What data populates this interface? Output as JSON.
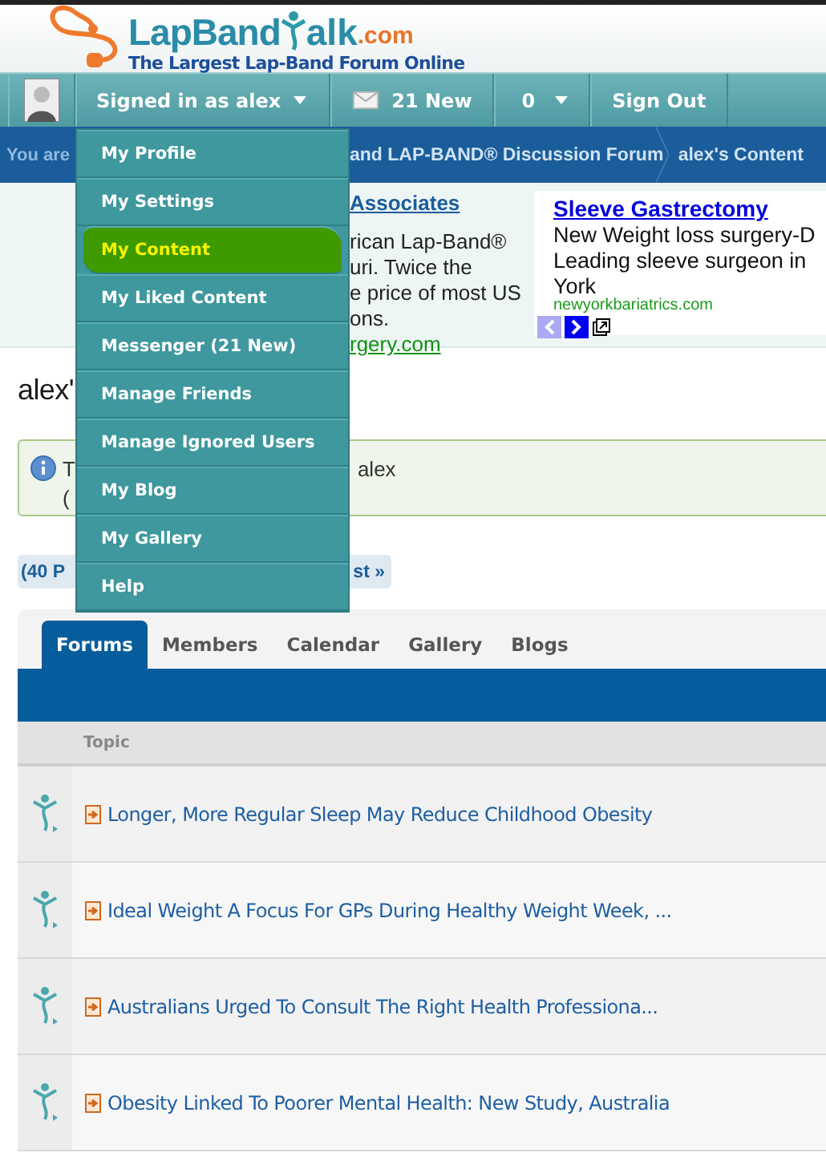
{
  "header": {
    "logo_parts": [
      "LapBand",
      "alk",
      ".com"
    ],
    "tagline": "The Largest Lap-Band Forum Online"
  },
  "nav": {
    "user": "Signed in as alex",
    "messages": "21 New",
    "notifications": "0",
    "sign_out": "Sign Out"
  },
  "breadcrumb": [
    "You are",
    "and LAP-BAND® Discussion Forum",
    "alex's Content"
  ],
  "user_menu": [
    {
      "label": "My Profile",
      "selected": false
    },
    {
      "label": "My Settings",
      "selected": false
    },
    {
      "label": "My Content",
      "selected": true
    },
    {
      "label": "My Liked Content",
      "selected": false
    },
    {
      "label": "Messenger (21 New)",
      "selected": false
    },
    {
      "label": "Manage Friends",
      "selected": false
    },
    {
      "label": "Manage Ignored Users",
      "selected": false
    },
    {
      "label": "My Blog",
      "selected": false
    },
    {
      "label": "My Gallery",
      "selected": false
    },
    {
      "label": "Help",
      "selected": false
    }
  ],
  "ads": {
    "left": {
      "title": "Associates",
      "lines": [
        "rican Lap-Band®",
        "uri. Twice the",
        "e price of most US",
        "ons."
      ],
      "url": "rgery.com"
    },
    "right": {
      "title": "Sleeve Gastrectomy",
      "lines": [
        "New Weight loss surgery-D",
        "Leading sleeve surgeon in",
        "York"
      ],
      "url": "newyorkbariatrics.com"
    }
  },
  "page_title": "alex'",
  "notice": {
    "start": "T",
    "end": "alex",
    "line2": "("
  },
  "pagination": {
    "start": "(40 P",
    "end": "st »"
  },
  "tabs": [
    {
      "label": "Forums",
      "selected": true
    },
    {
      "label": "Members",
      "selected": false
    },
    {
      "label": "Calendar",
      "selected": false
    },
    {
      "label": "Gallery",
      "selected": false
    },
    {
      "label": "Blogs",
      "selected": false
    }
  ],
  "table": {
    "columns": [
      "Topic"
    ],
    "rows": [
      {
        "topic": "Longer, More Regular Sleep May Reduce Childhood Obesity"
      },
      {
        "topic": "Ideal Weight A Focus For GPs During Healthy Weight Week, ..."
      },
      {
        "topic": "Australians Urged To Consult The Right Health Professiona..."
      },
      {
        "topic": "Obesity Linked To Poorer Mental Health: New Study, Australia"
      }
    ]
  }
}
